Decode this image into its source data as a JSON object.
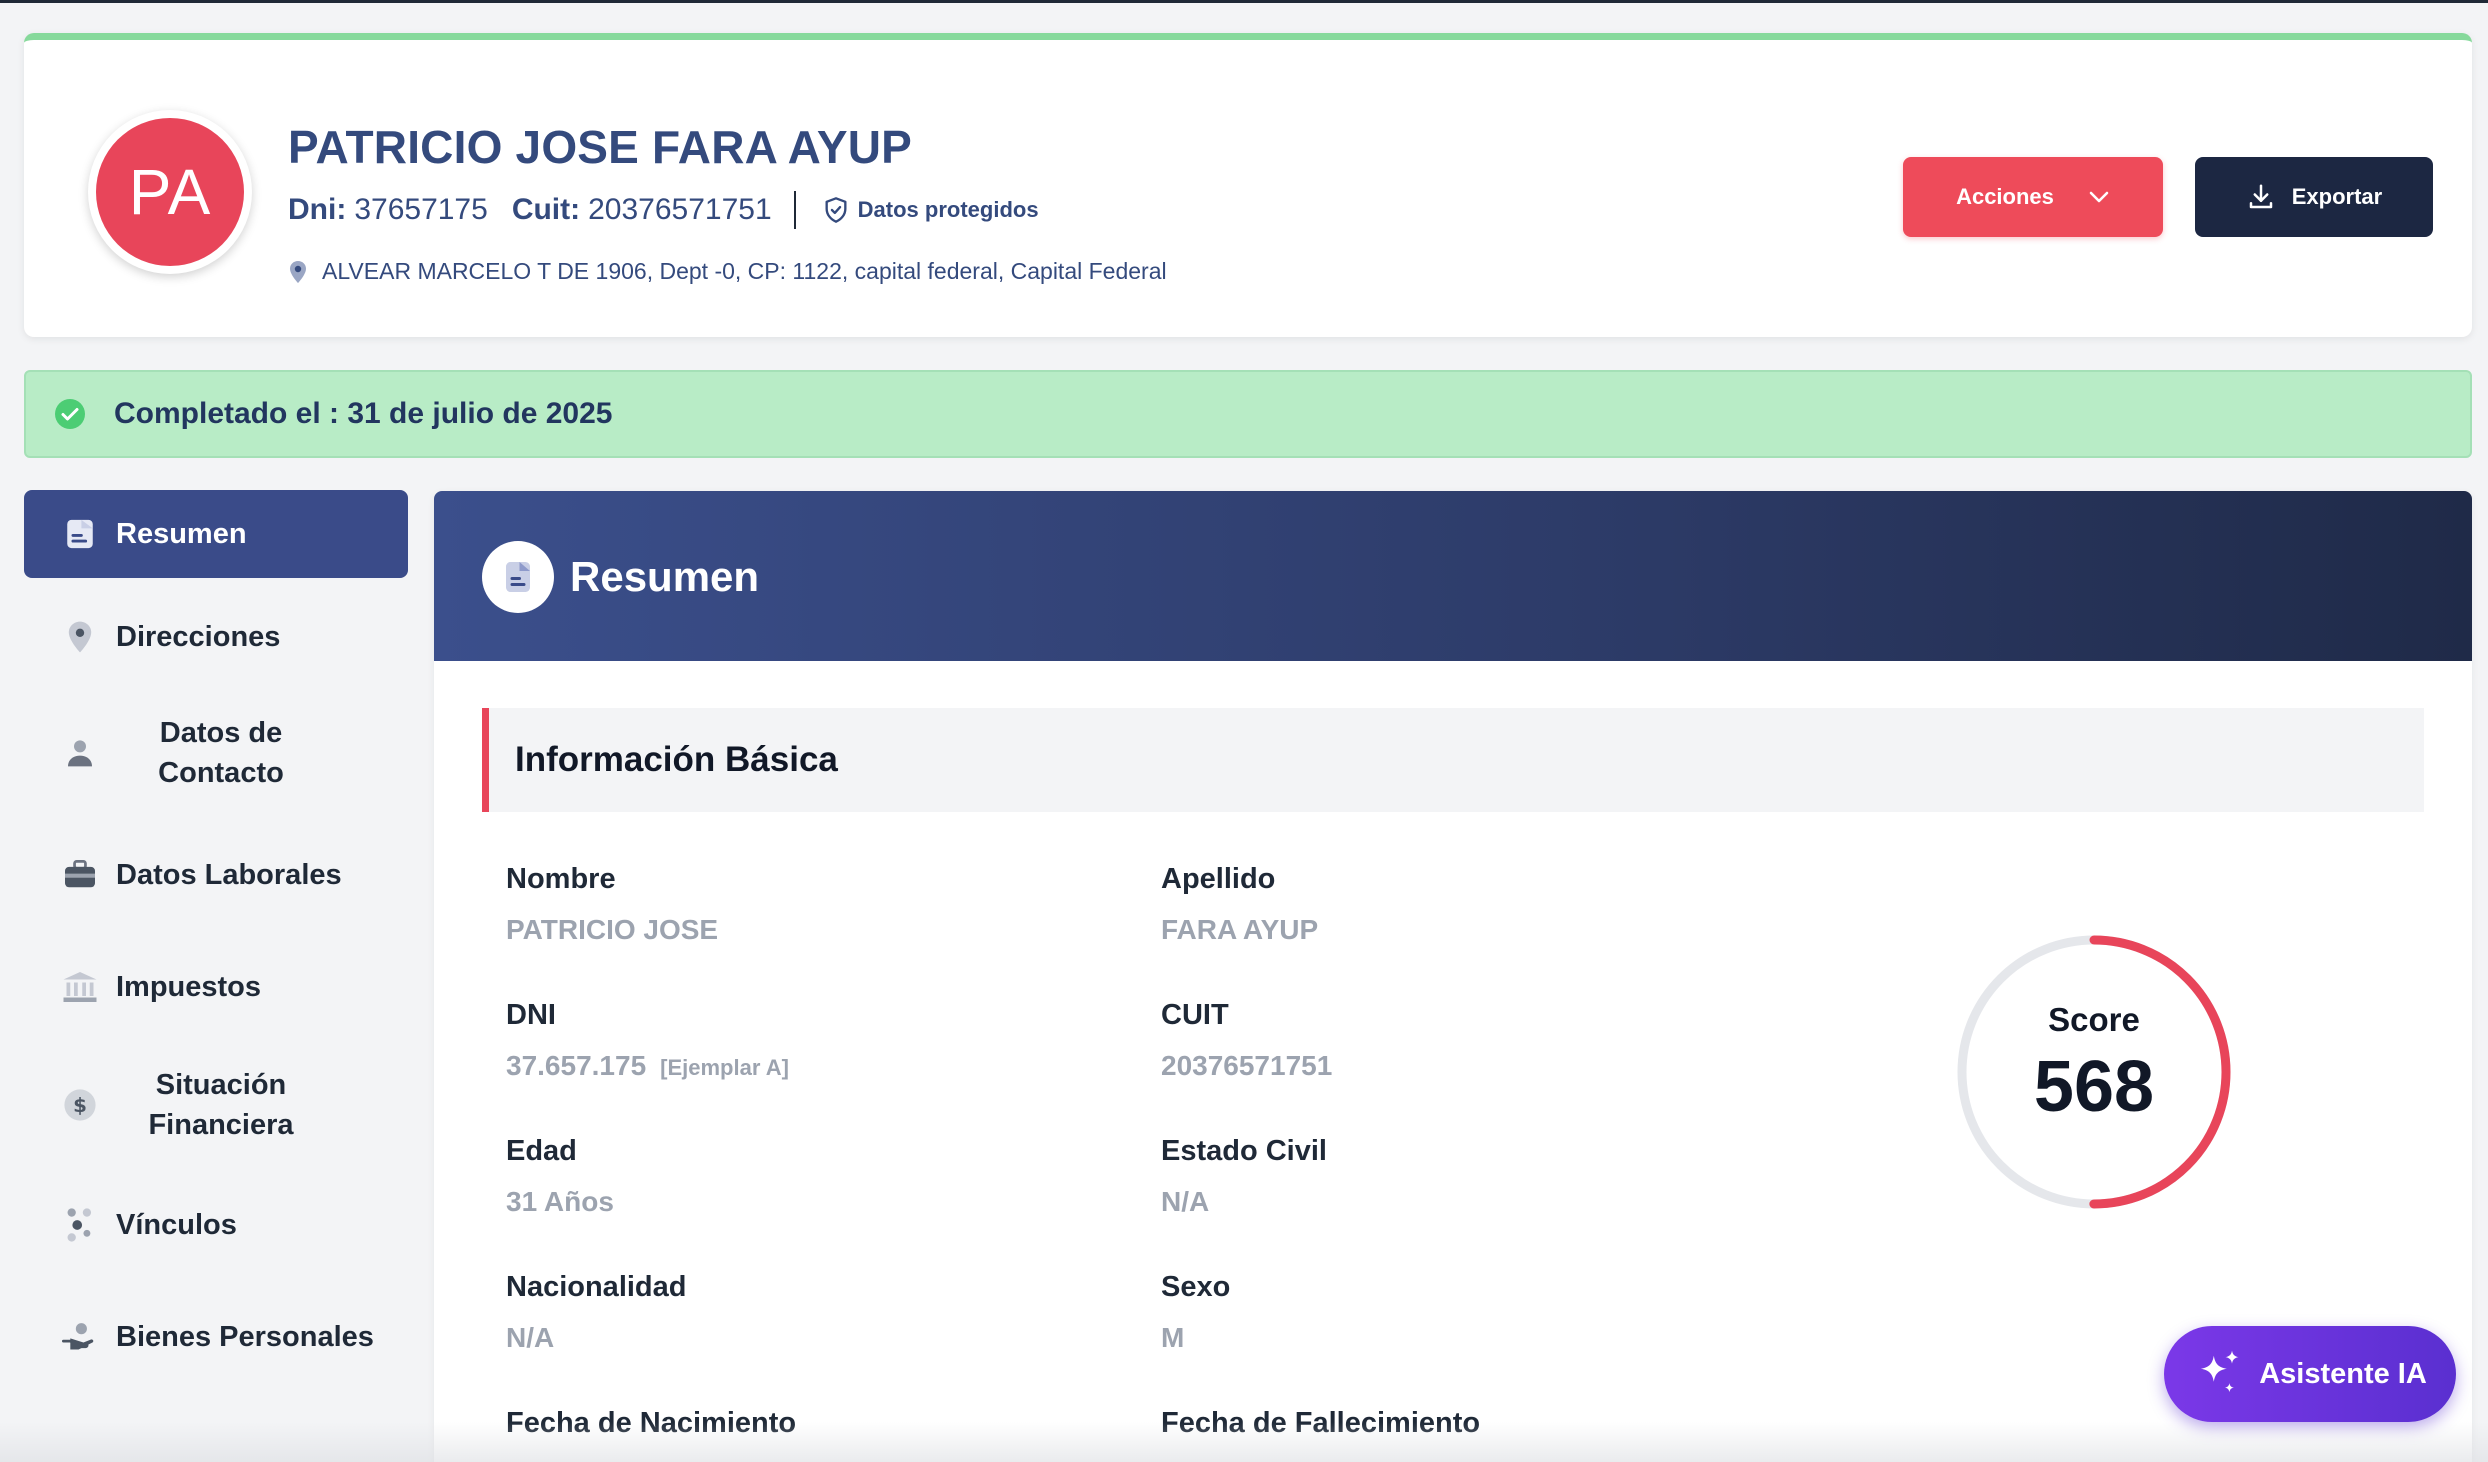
{
  "profile": {
    "initials": "PA",
    "name": "PATRICIO JOSE FARA AYUP",
    "dni_label": "Dni:",
    "dni": "37657175",
    "cuit_label": "Cuit:",
    "cuit": "20376571751",
    "protected_label": "Datos protegidos",
    "address": "ALVEAR MARCELO T DE 1906, Dept -0, CP: 1122, capital federal, Capital Federal"
  },
  "actions": {
    "acciones_label": "Acciones",
    "exportar_label": "Exportar"
  },
  "status": {
    "text": "Completado el : 31 de julio de 2025"
  },
  "sidebar": {
    "items": [
      {
        "label": "Resumen",
        "icon": "document-icon",
        "active": true
      },
      {
        "label": "Direcciones",
        "icon": "location-pin-icon"
      },
      {
        "label": "Datos de Contacto",
        "icon": "user-icon"
      },
      {
        "label": "Datos Laborales",
        "icon": "briefcase-icon"
      },
      {
        "label": "Impuestos",
        "icon": "bank-icon"
      },
      {
        "label": "Situación Financiera",
        "icon": "dollar-icon"
      },
      {
        "label": "Vínculos",
        "icon": "people-network-icon"
      },
      {
        "label": "Bienes Personales",
        "icon": "hand-holding-icon"
      }
    ]
  },
  "main": {
    "title": "Resumen",
    "section_title": "Información Básica",
    "fields": {
      "nombre": {
        "label": "Nombre",
        "value": "PATRICIO JOSE"
      },
      "apellido": {
        "label": "Apellido",
        "value": "FARA AYUP"
      },
      "dni": {
        "label": "DNI",
        "value": "37.657.175",
        "note": "[Ejemplar A]"
      },
      "cuit": {
        "label": "CUIT",
        "value": "20376571751"
      },
      "edad": {
        "label": "Edad",
        "value": "31 Años"
      },
      "estado_civil": {
        "label": "Estado Civil",
        "value": "N/A"
      },
      "nacionalidad": {
        "label": "Nacionalidad",
        "value": "N/A"
      },
      "sexo": {
        "label": "Sexo",
        "value": "M"
      },
      "fecha_nacimiento": {
        "label": "Fecha de Nacimiento"
      },
      "fecha_fallecimiento": {
        "label": "Fecha de Fallecimiento"
      }
    },
    "score": {
      "label": "Score",
      "value": "568",
      "fill_fraction": 0.5
    }
  },
  "assistant": {
    "label": "Asistente IA"
  },
  "colors": {
    "accent_red": "#ee4b5a",
    "navy": "#1c2742",
    "brand_blue": "#344a7d",
    "success_green": "#b8ecc6",
    "ai_purple": "#6b34dc"
  }
}
